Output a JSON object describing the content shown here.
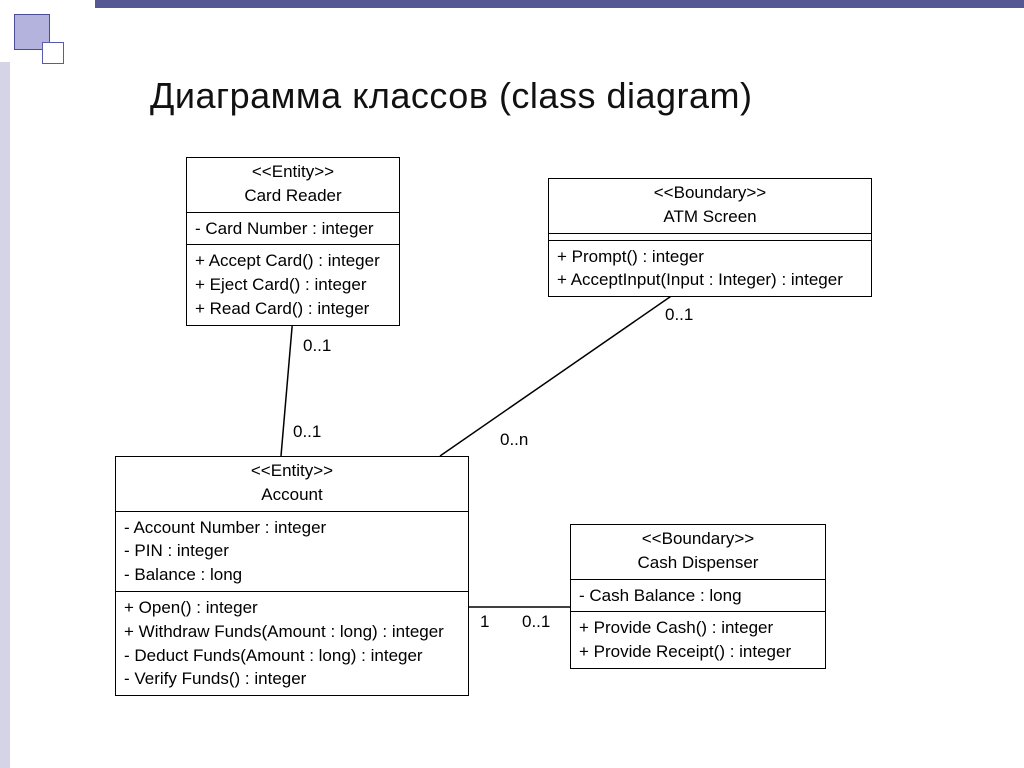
{
  "title": "Диаграмма классов (class diagram)",
  "classes": {
    "cardReader": {
      "stereotype": "<<Entity>>",
      "name": "Card Reader",
      "attributes": [
        "- Card Number : integer"
      ],
      "operations": [
        "+ Accept Card() : integer",
        "+ Eject Card() : integer",
        "+ Read Card() : integer"
      ]
    },
    "atmScreen": {
      "stereotype": "<<Boundary>>",
      "name": "ATM Screen",
      "attributes": [],
      "operations": [
        "+ Prompt() : integer",
        "+ AcceptInput(Input : Integer) : integer"
      ]
    },
    "account": {
      "stereotype": "<<Entity>>",
      "name": "Account",
      "attributes": [
        "- Account Number : integer",
        "- PIN : integer",
        "- Balance : long"
      ],
      "operations": [
        "+ Open() : integer",
        "+ Withdraw Funds(Amount : long) : integer",
        "- Deduct Funds(Amount : long) : integer",
        "- Verify Funds() : integer"
      ]
    },
    "cashDispenser": {
      "stereotype": "<<Boundary>>",
      "name": "Cash Dispenser",
      "attributes": [
        "- Cash Balance : long"
      ],
      "operations": [
        "+ Provide Cash() : integer",
        "+ Provide Receipt() : integer"
      ]
    }
  },
  "multiplicities": {
    "cr_acc_top": "0..1",
    "cr_acc_bottom": "0..1",
    "atm_acc_top": "0..1",
    "atm_acc_bottom": "0..n",
    "acc_cash_left": "1",
    "acc_cash_right": "0..1"
  }
}
